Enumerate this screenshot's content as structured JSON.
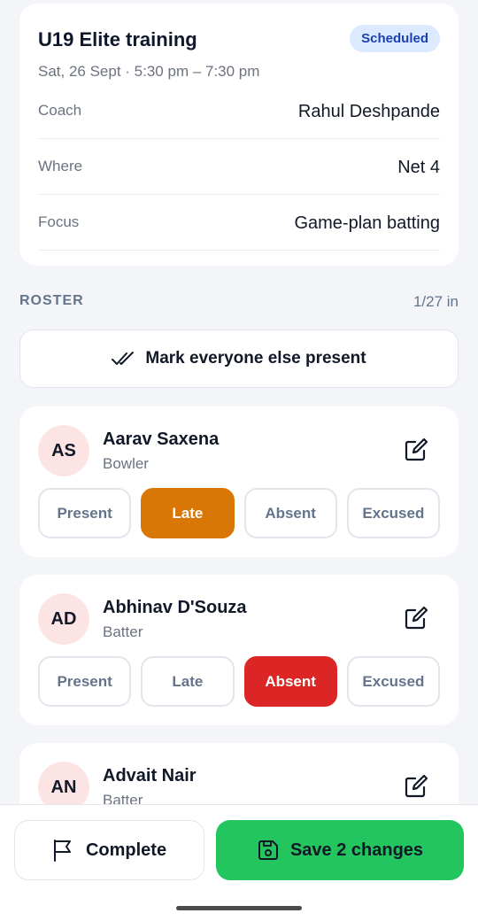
{
  "session": {
    "title": "U19 Elite training",
    "status": "Scheduled",
    "time": "Sat, 26 Sept · 5:30 pm – 7:30 pm",
    "details": [
      {
        "label": "Coach",
        "value": "Rahul Deshpande"
      },
      {
        "label": "Where",
        "value": "Net 4"
      },
      {
        "label": "Focus",
        "value": "Game-plan batting"
      }
    ]
  },
  "roster": {
    "header": "ROSTER",
    "count": "1/27 in",
    "mark_all_label": "Mark everyone else present",
    "status_options": [
      "Present",
      "Late",
      "Absent",
      "Excused"
    ],
    "players": [
      {
        "initials": "AS",
        "name": "Aarav Saxena",
        "role": "Bowler",
        "status": "Late"
      },
      {
        "initials": "AD",
        "name": "Abhinav D'Souza",
        "role": "Batter",
        "status": "Absent"
      },
      {
        "initials": "AN",
        "name": "Advait Nair",
        "role": "Batter",
        "status": ""
      }
    ]
  },
  "actions": {
    "complete_label": "Complete",
    "save_label": "Save 2 changes"
  },
  "colors": {
    "accent_green": "#22c55e",
    "late": "#d97706",
    "absent": "#dc2626",
    "badge_bg": "#dbeafe",
    "badge_text": "#1e40af"
  },
  "icons": {
    "mark_all": "double-check-icon",
    "edit": "edit-icon",
    "complete": "flag-icon",
    "save": "save-icon"
  }
}
